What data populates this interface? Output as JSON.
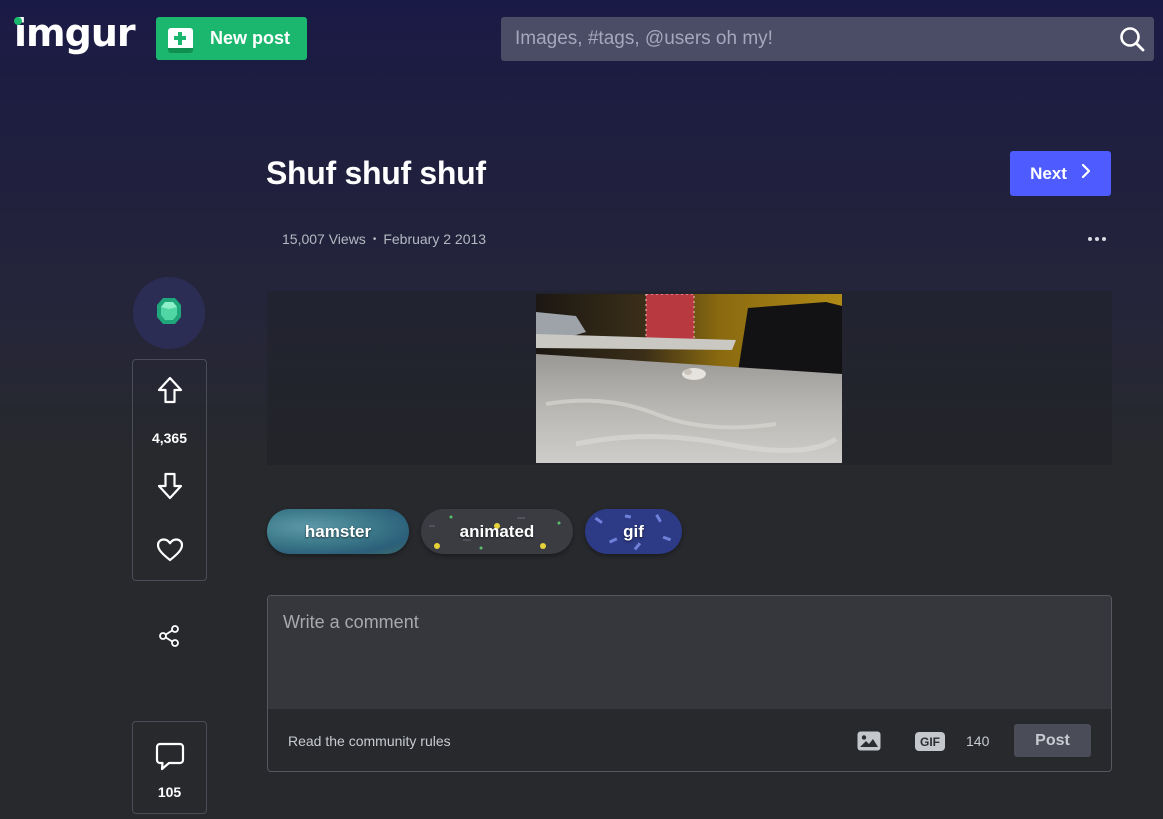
{
  "header": {
    "logo_text": "imgur",
    "new_post_label": "New post",
    "search_placeholder": "Images, #tags, @users oh my!"
  },
  "post": {
    "title": "Shuf shuf shuf",
    "next_label": "Next",
    "views": "15,007 Views",
    "date": "February 2 2013"
  },
  "rail": {
    "vote_count": "4,365",
    "comment_count": "105"
  },
  "tags": [
    {
      "label": "hamster"
    },
    {
      "label": "animated"
    },
    {
      "label": "gif"
    }
  ],
  "comment": {
    "placeholder": "Write a comment",
    "rules_link": "Read the community rules",
    "gif_label": "GIF",
    "char_count": "140",
    "post_label": "Post"
  },
  "colors": {
    "brand_green": "#1bb76e",
    "next_blue": "#4e5cff",
    "search_bg": "#4b4c66"
  },
  "icons": {
    "new_post": "plus-icon",
    "search": "search-icon",
    "next": "chevron-right-icon",
    "more": "more-icon",
    "avatar": "emerald-gem-icon",
    "upvote": "arrow-up-icon",
    "downvote": "arrow-down-icon",
    "favorite": "heart-icon",
    "share": "share-icon",
    "comments": "speech-bubble-icon",
    "image_upload": "image-icon"
  }
}
